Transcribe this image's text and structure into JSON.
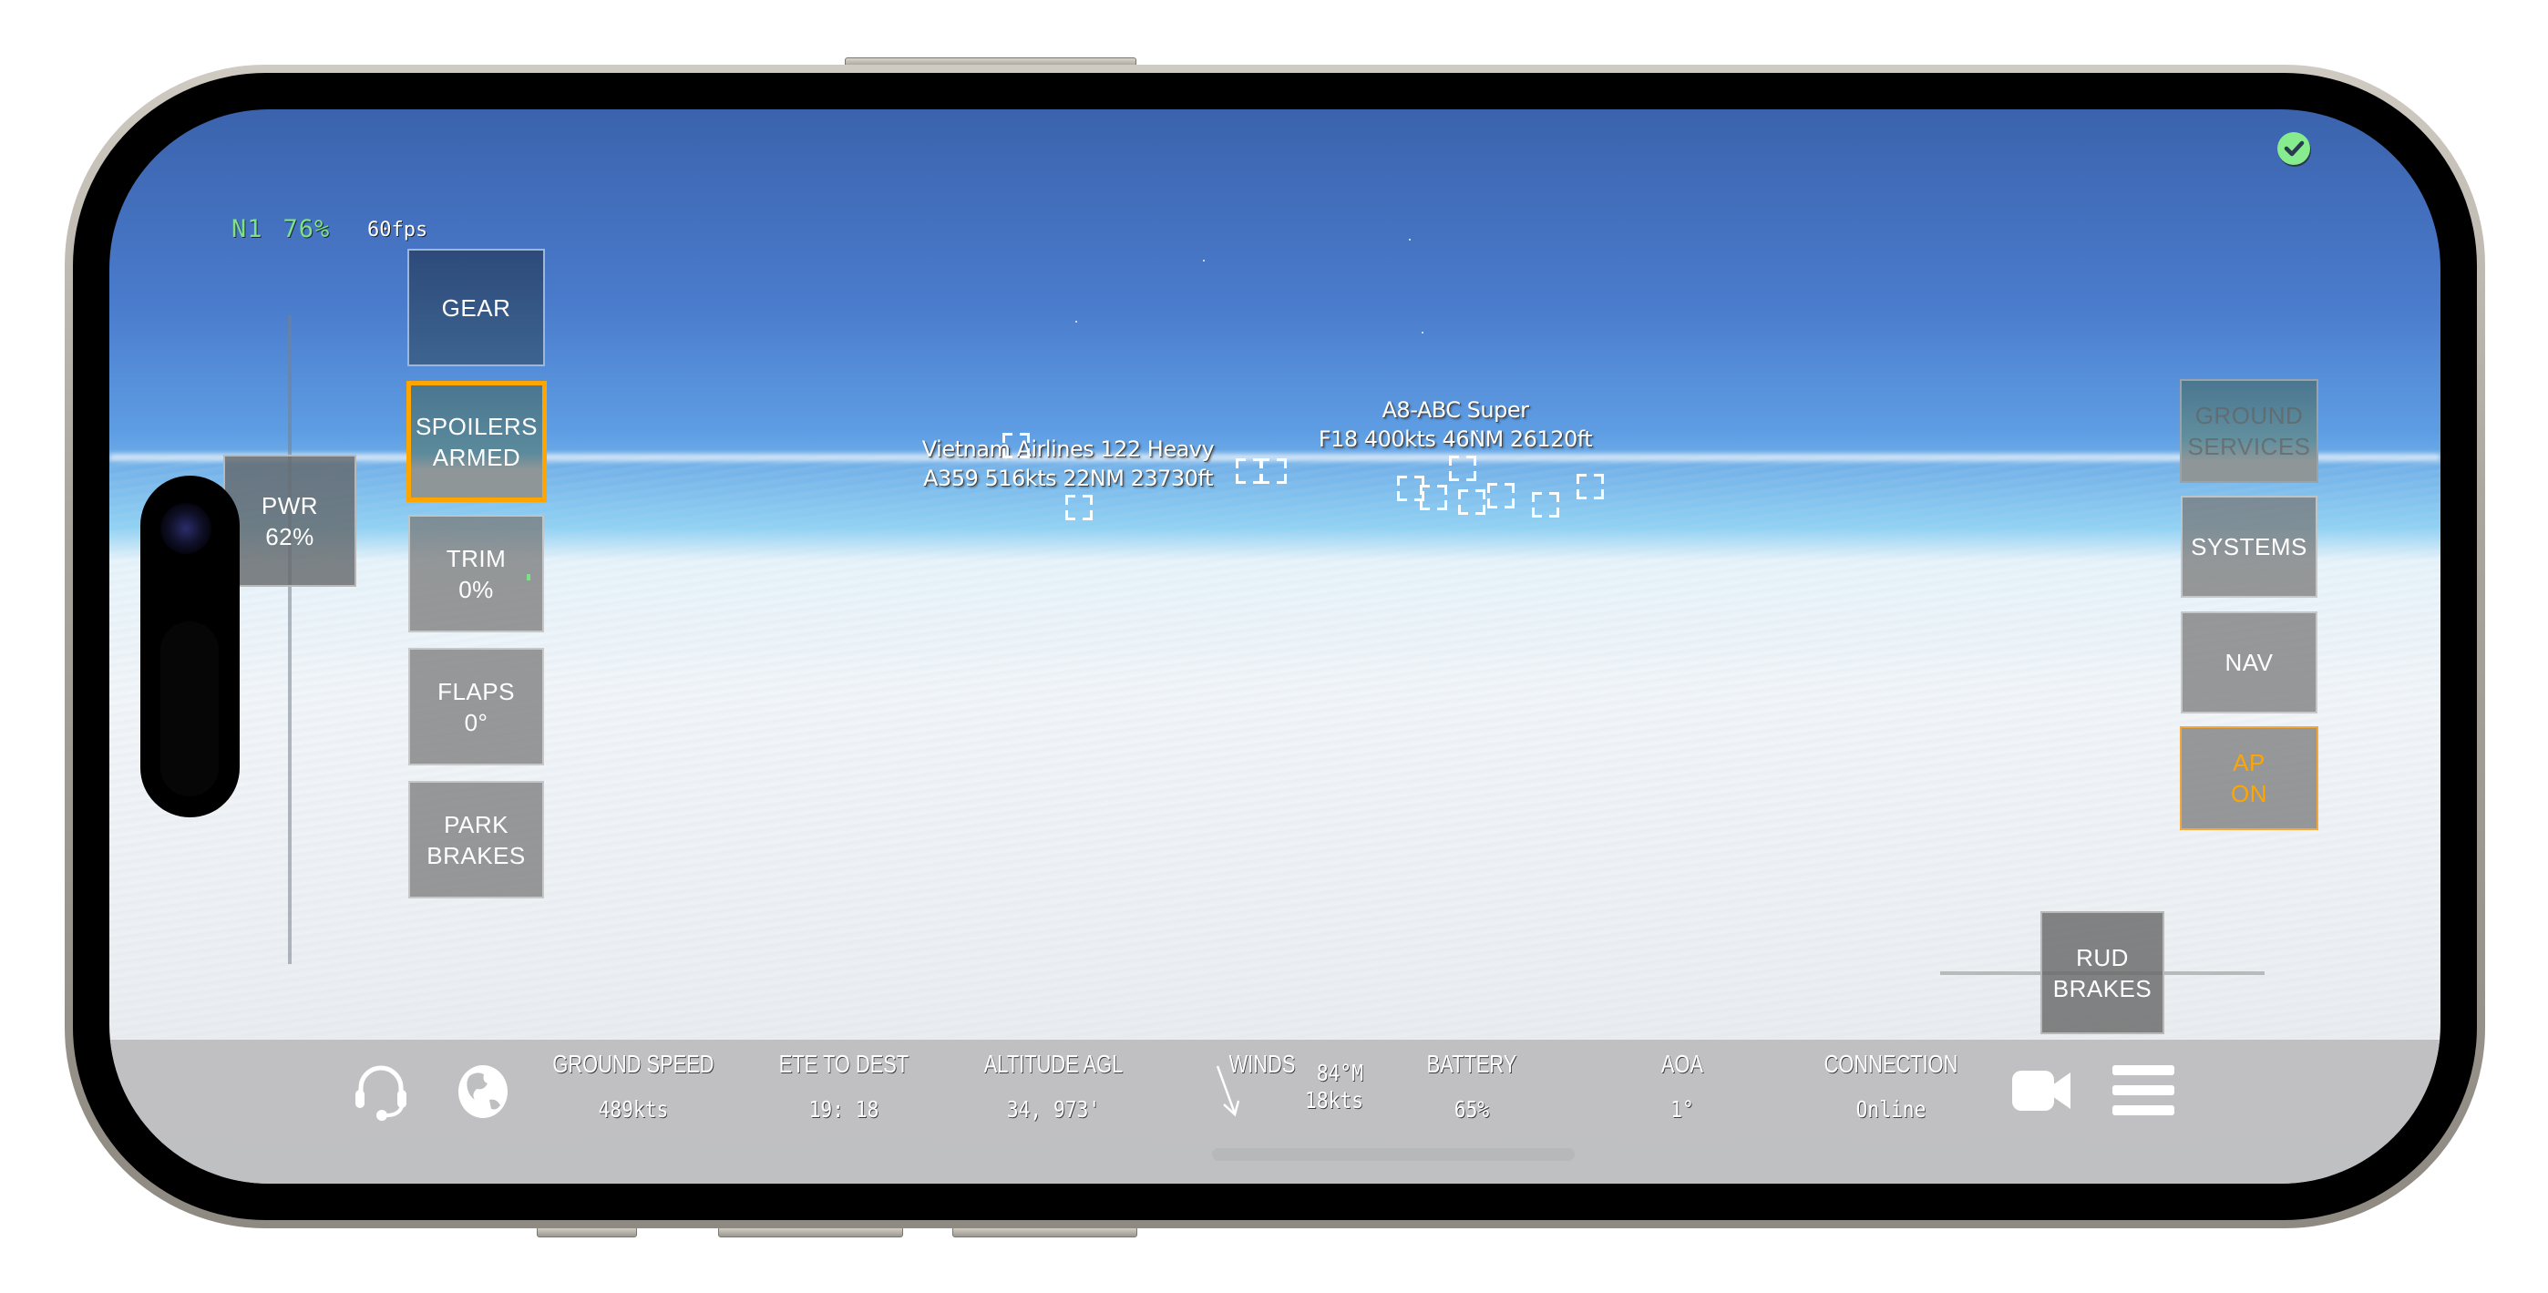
{
  "hud": {
    "n1_label": "N1",
    "n1_value": "76%",
    "fps": "60fps",
    "status_icon": "check-circle-icon"
  },
  "left_panel": {
    "power": {
      "label": "PWR",
      "value": "62%",
      "throttle_fraction": 0.62
    },
    "buttons": [
      {
        "id": "gear",
        "line1": "GEAR",
        "line2": ""
      },
      {
        "id": "spoilers",
        "line1": "SPOILERS",
        "line2": "ARMED",
        "active": true
      },
      {
        "id": "trim",
        "line1": "TRIM",
        "line2": "0%"
      },
      {
        "id": "flaps",
        "line1": "FLAPS",
        "line2": "0°"
      },
      {
        "id": "park-brakes",
        "line1": "PARK",
        "line2": "BRAKES"
      }
    ]
  },
  "right_panel": {
    "buttons": [
      {
        "id": "ground-services",
        "line1": "GROUND",
        "line2": "SERVICES",
        "disabled": true
      },
      {
        "id": "systems",
        "line1": "SYSTEMS",
        "line2": ""
      },
      {
        "id": "nav",
        "line1": "NAV",
        "line2": ""
      },
      {
        "id": "autopilot",
        "line1": "AP",
        "line2": "ON",
        "active": true
      }
    ],
    "rudder": {
      "line1": "RUD",
      "line2": "BRAKES"
    }
  },
  "traffic": [
    {
      "line1": "Vietnam Airlines 122 Heavy",
      "line2": "A359 516kts 22NM 23730ft"
    },
    {
      "line1": "A8-ABC Super",
      "line2": "F18 400kts 46NM 26120ft"
    }
  ],
  "bottom_bar": {
    "left_icons": [
      "headset-icon",
      "globe-icon"
    ],
    "stats": [
      {
        "label": "GROUND SPEED",
        "value": "489kts"
      },
      {
        "label": "ETE TO DEST",
        "value": "19: 18"
      },
      {
        "label": "ALTITUDE AGL",
        "value": "34, 973'"
      },
      {
        "label": "WINDS",
        "value": ""
      },
      {
        "label": "BATTERY",
        "value": "65%"
      },
      {
        "label": "AOA",
        "value": "1°"
      },
      {
        "label": "CONNECTION",
        "value": "Online"
      }
    ],
    "winds": {
      "direction": "84°M",
      "speed": "18kts",
      "arrow_icon": "wind-arrow-icon"
    },
    "right_icons": [
      "camera-icon",
      "menu-icon"
    ]
  },
  "colors": {
    "n1_green": "#7fe08a",
    "active_orange": "#ffa500",
    "status_green": "#86ec8d"
  }
}
